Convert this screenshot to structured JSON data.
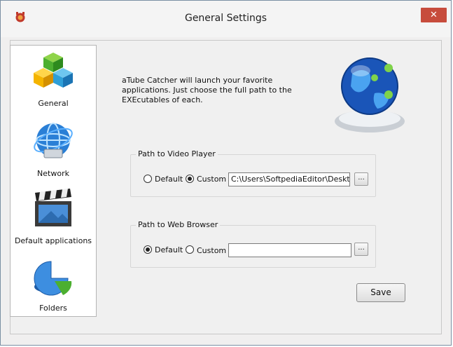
{
  "window": {
    "title": "General Settings",
    "close_label": "✕"
  },
  "sidebar": {
    "items": [
      {
        "label": "General",
        "icon": "general-cubes-icon"
      },
      {
        "label": "Network",
        "icon": "network-globe-icon"
      },
      {
        "label": "Default applications",
        "icon": "clapperboard-icon"
      },
      {
        "label": "Folders",
        "icon": "folders-pie-icon"
      }
    ]
  },
  "content": {
    "description": "aTube Catcher will launch your favorite applications. Just choose the full path to the EXEcutables of each.",
    "video_player": {
      "title": "Path to Video Player",
      "default_label": "Default",
      "custom_label": "Custom",
      "selected": "Custom",
      "path": "C:\\Users\\SoftpediaEditor\\Desktop\\",
      "browse_label": "..."
    },
    "web_browser": {
      "title": "Path to Web Browser",
      "default_label": "Default",
      "custom_label": "Custom",
      "selected": "Default",
      "path": "",
      "browse_label": "..."
    },
    "save_label": "Save"
  }
}
